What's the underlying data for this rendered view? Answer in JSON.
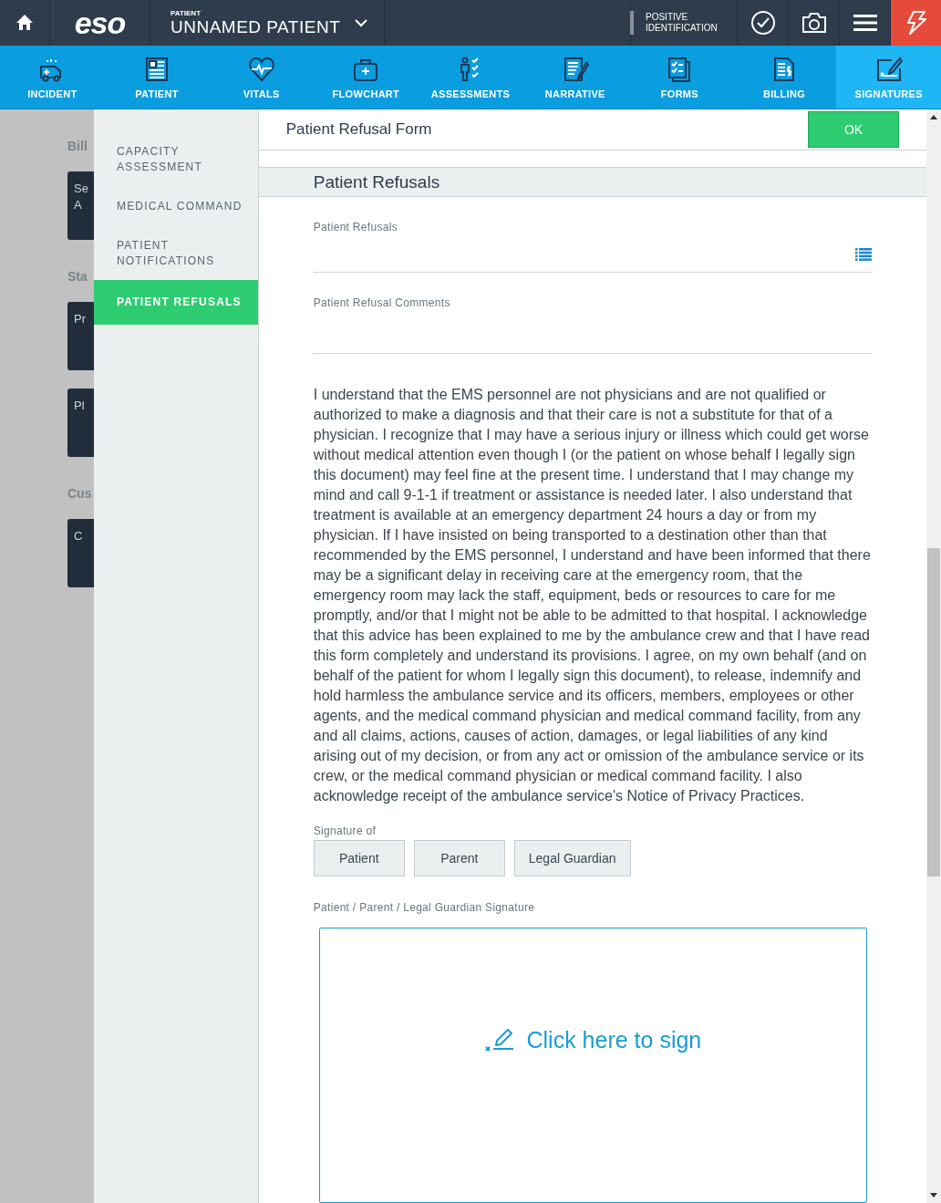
{
  "top_bar": {
    "logo": "eso",
    "patient_label": "PATIENT",
    "patient_name": "UNNAMED PATIENT",
    "identification": "POSITIVE IDENTIFICATION"
  },
  "nav_tabs": [
    {
      "label": "INCIDENT",
      "selected": false
    },
    {
      "label": "PATIENT",
      "selected": false
    },
    {
      "label": "VITALS",
      "selected": false
    },
    {
      "label": "FLOWCHART",
      "selected": false
    },
    {
      "label": "ASSESSMENTS",
      "selected": false
    },
    {
      "label": "NARRATIVE",
      "selected": false
    },
    {
      "label": "FORMS",
      "selected": false
    },
    {
      "label": "BILLING",
      "selected": false
    },
    {
      "label": "SIGNATURES",
      "selected": true
    }
  ],
  "background_page": {
    "sections": [
      {
        "heading": "Bill",
        "cards": [
          [
            "Se",
            "A"
          ]
        ]
      },
      {
        "heading": "Sta",
        "cards": [
          [
            "Pr"
          ],
          [
            "Pl"
          ]
        ]
      },
      {
        "heading": "Cus",
        "cards": [
          [
            "C"
          ]
        ]
      }
    ]
  },
  "sidebar": {
    "items": [
      {
        "label": "CAPACITY ASSESSMENT",
        "selected": false
      },
      {
        "label": "MEDICAL COMMAND",
        "selected": false
      },
      {
        "label": "PATIENT NOTIFICATIONS",
        "selected": false
      },
      {
        "label": "PATIENT REFUSALS",
        "selected": true
      }
    ]
  },
  "form": {
    "title": "Patient Refusal Form",
    "ok_button": "OK",
    "section_title": "Patient Refusals",
    "fields": [
      {
        "label": "Patient Refusals",
        "kind": "list"
      },
      {
        "label": "Patient Refusal Comments",
        "kind": "text"
      }
    ],
    "statement": "I understand that the EMS personnel are not physicians and are not qualified or authorized to make a diagnosis and that their care is not a substitute for that of a physician. I recognize that I may have a serious injury or illness which could get worse without medical attention even though I (or the patient on whose behalf I legally sign this document) may feel fine at the present time.  I understand that I may change my mind and call 9-1-1 if treatment or assistance is needed later. I also understand that treatment is available at an emergency department 24 hours a day or from my physician. If I have insisted on being transported to a destination other than that recommended by the EMS personnel, I understand and have been informed that there may be a significant delay in receiving care at the emergency room, that the emergency room may lack the staff, equipment, beds or resources to care for me promptly, and/or that I might not be able to be admitted to that hospital.  I acknowledge that this advice has been explained to me by the ambulance crew and that I have read this form completely and understand its provisions. I agree, on my own behalf (and on behalf of the patient for whom I legally sign this document), to release, indemnify and hold harmless the ambulance service and its officers, members, employees or other agents, and the medical command physician and medical command facility, from any and all claims, actions, causes of action, damages, or legal liabilities of any kind arising out of my decision, or from any act or omission of the ambulance service or its crew, or the medical command physician or medical command facility.  I also acknowledge receipt of the ambulance service's Notice of Privacy Practices.",
    "signature_of_label": "Signature of",
    "signature_of_options": [
      {
        "label": "Patient",
        "selected": false
      },
      {
        "label": "Parent",
        "selected": false
      },
      {
        "label": "Legal Guardian",
        "selected": false
      }
    ],
    "signature_label": "Patient / Parent / Legal Guardian Signature",
    "sign_prompt": "Click here to sign"
  }
}
